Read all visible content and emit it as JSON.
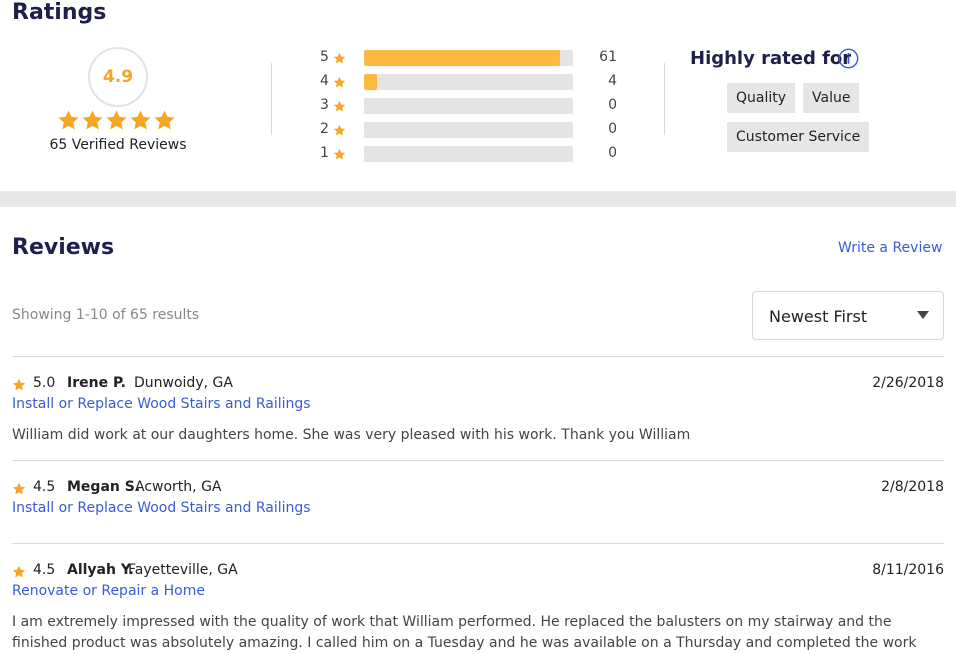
{
  "ratings": {
    "title": "Ratings",
    "score": "4.9",
    "verified": "65 Verified Reviews",
    "star_color": "#f5a623",
    "distribution": [
      {
        "stars": "5",
        "count": "61",
        "fraction": 0.94
      },
      {
        "stars": "4",
        "count": "4",
        "fraction": 0.06
      },
      {
        "stars": "3",
        "count": "0",
        "fraction": 0
      },
      {
        "stars": "2",
        "count": "0",
        "fraction": 0
      },
      {
        "stars": "1",
        "count": "0",
        "fraction": 0
      }
    ],
    "highly_rated": {
      "title": "Highly rated for",
      "tags": [
        "Quality",
        "Value",
        "Customer Service"
      ]
    }
  },
  "reviews": {
    "title": "Reviews",
    "write_link": "Write a Review",
    "showing": "Showing 1-10 of 65 results",
    "sort": {
      "selected": "Newest First"
    },
    "items": [
      {
        "rating": "5.0",
        "name": "Irene P.",
        "location": "Dunwoidy, GA",
        "date": "2/26/2018",
        "service": "Install or Replace Wood Stairs and Railings",
        "text": "William did work at our daughters home. She was very pleased with his work. Thank you William"
      },
      {
        "rating": "4.5",
        "name": "Megan S.",
        "location": "Acworth, GA",
        "date": "2/8/2018",
        "service": "Install or Replace Wood Stairs and Railings",
        "text": ""
      },
      {
        "rating": "4.5",
        "name": "Allyah Y.",
        "location": "Fayetteville, GA",
        "date": "8/11/2016",
        "service": "Renovate or Repair a Home",
        "text": "I am extremely impressed with the quality of work that William performed. He replaced the balusters on my stairway and the finished product was absolutely amazing. I called him on a Tuesday and he was available on a Thursday and completed the work"
      }
    ]
  }
}
